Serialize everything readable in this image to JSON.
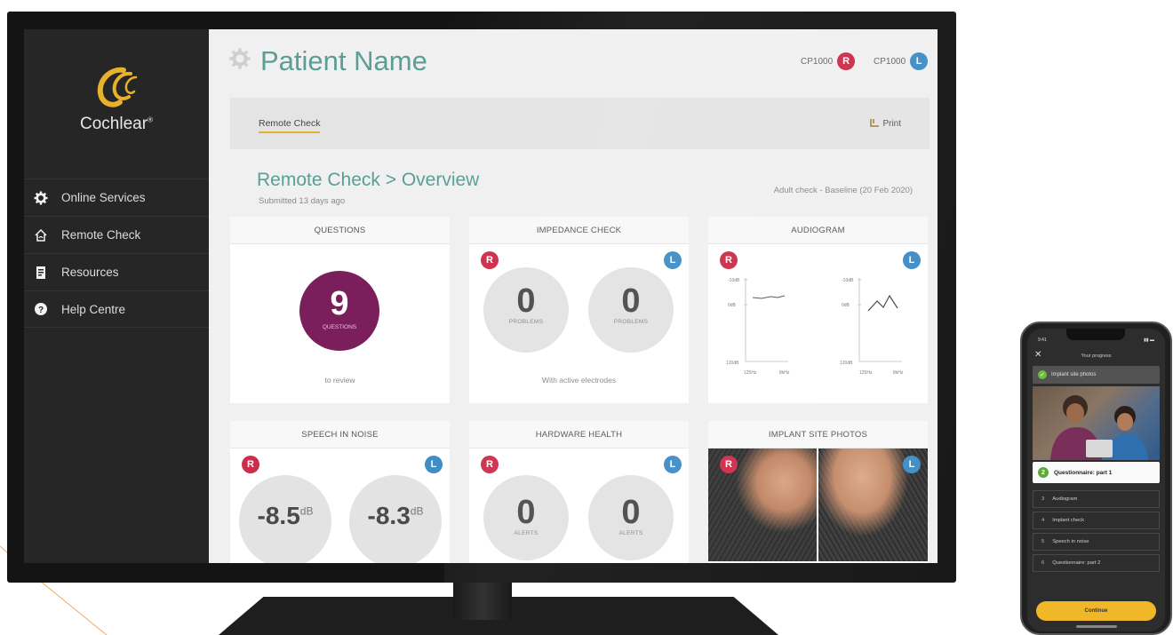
{
  "brand": {
    "name": "Cochlear",
    "registered": "®",
    "accent_color": "#e8b12c"
  },
  "sidebar": {
    "items": [
      {
        "label": "Online Services",
        "icon": "gear-icon"
      },
      {
        "label": "Remote Check",
        "icon": "remote-check-icon"
      },
      {
        "label": "Resources",
        "icon": "resources-icon"
      },
      {
        "label": "Help Centre",
        "icon": "help-icon"
      }
    ]
  },
  "header": {
    "title": "Patient Name",
    "devices": [
      {
        "model": "CP1000",
        "side": "R"
      },
      {
        "model": "CP1000",
        "side": "L"
      }
    ]
  },
  "toolbar": {
    "tab_label": "Remote Check",
    "print_label": "Print"
  },
  "overview": {
    "breadcrumb": "Remote Check > Overview",
    "submitted": "Submitted 13 days ago",
    "check_type": "Adult check - Baseline (20 Feb 2020)"
  },
  "cards": {
    "questions": {
      "title": "QUESTIONS",
      "count": "9",
      "count_label": "QUESTIONS",
      "caption": "to review"
    },
    "impedance": {
      "title": "IMPEDANCE CHECK",
      "right": {
        "value": "0",
        "label": "PROBLEMS"
      },
      "left": {
        "value": "0",
        "label": "PROBLEMS"
      },
      "caption": "With active electrodes"
    },
    "audiogram": {
      "title": "AUDIOGRAM",
      "right": {
        "y_top": "-10dB",
        "y_mid": "0dB",
        "y_bottom": "120dB",
        "x_left": "125Hz",
        "x_right": "8kHz"
      },
      "left": {
        "y_top": "-10dB",
        "y_mid": "0dB",
        "y_bottom": "120dB",
        "x_left": "125Hz",
        "x_right": "8kHz"
      }
    },
    "speech_in_noise": {
      "title": "SPEECH IN NOISE",
      "right": {
        "value": "-8.5",
        "unit": "dB"
      },
      "left": {
        "value": "-8.3",
        "unit": "dB"
      }
    },
    "hardware_health": {
      "title": "HARDWARE HEALTH",
      "right": {
        "value": "0",
        "label": "ALERTS"
      },
      "left": {
        "value": "0",
        "label": "ALERTS"
      }
    },
    "implant_photos": {
      "title": "IMPLANT SITE PHOTOS"
    }
  },
  "badges": {
    "right": "R",
    "left": "L",
    "right_color": "#cc2d4a",
    "left_color": "#3f8dc6"
  },
  "phone": {
    "time": "9:41",
    "title": "Your progress",
    "steps": [
      {
        "num": "1",
        "label": "Implant site photos",
        "state": "done"
      },
      {
        "num": "2",
        "label": "Questionnaire: part 1",
        "state": "active"
      },
      {
        "num": "3",
        "label": "Audiogram",
        "state": "todo"
      },
      {
        "num": "4",
        "label": "Implant check",
        "state": "todo"
      },
      {
        "num": "5",
        "label": "Speech in noise",
        "state": "todo"
      },
      {
        "num": "6",
        "label": "Questionnaire: part 2",
        "state": "todo"
      }
    ],
    "continue_label": "Continue"
  }
}
